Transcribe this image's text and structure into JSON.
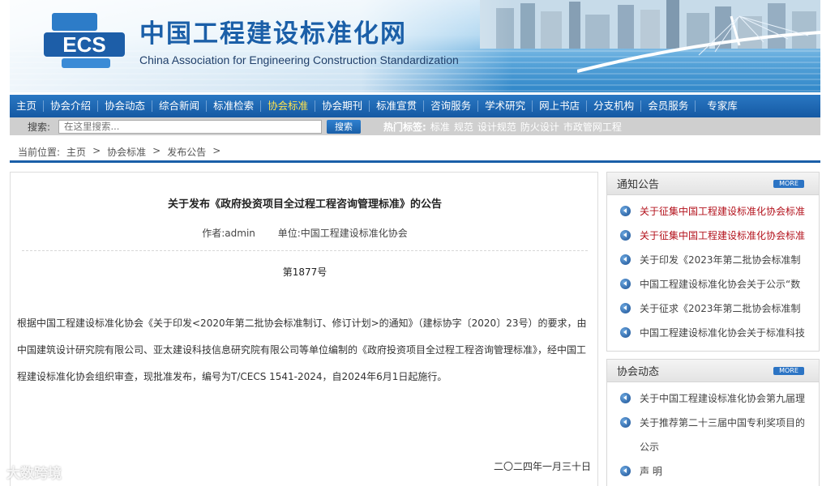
{
  "header": {
    "title": "中国工程建设标准化网",
    "subtitle": "China Association for Engineering Construction Standardization",
    "logo_text": "ECS"
  },
  "nav": {
    "items": [
      "主页",
      "协会介绍",
      "协会动态",
      "综合新闻",
      "标准检索",
      "协会标准",
      "协会期刊",
      "标准宣贯",
      "咨询服务",
      "学术研究",
      "网上书店",
      "分支机构",
      "会员服务",
      "专家库"
    ],
    "active": "协会标准"
  },
  "search": {
    "label": "搜索:",
    "placeholder": "在这里搜索...",
    "button": "搜索",
    "hot_label": "热门标签:",
    "hot_tags": [
      "标准",
      "规范",
      "设计规范",
      "防火设计",
      "市政管网工程"
    ]
  },
  "breadcrumb": {
    "prefix": "当前位置:",
    "items": [
      "主页",
      "协会标准",
      "发布公告"
    ],
    "sep": ">"
  },
  "article": {
    "title": "关于发布《政府投资项目全过程工程咨询管理标准》的公告",
    "author": "作者:admin",
    "unit": "单位:中国工程建设标准化协会",
    "number": "第1877号",
    "body": "根据中国工程建设标准化协会《关于印发<2020年第二批协会标准制订、修订计划>的通知》（建标协字〔2020〕23号）的要求，由中国建筑设计研究院有限公司、亚太建设科技信息研究院有限公司等单位编制的《政府投资项目全过程工程咨询管理标准》，经中国工程建设标准化协会组织审查，现批准发布，编号为T/CECS 1541-2024，自2024年6月1日起施行。",
    "date": "二〇二四年一月三十日"
  },
  "sidebar": {
    "more_label": "MORE",
    "notices": {
      "title": "通知公告",
      "items": [
        {
          "text": "关于征集中国工程建设标准化协会标准",
          "highlight": true
        },
        {
          "text": "关于征集中国工程建设标准化协会标准",
          "highlight": true
        },
        {
          "text": "关于印发《2023年第二批协会标准制",
          "highlight": false
        },
        {
          "text": "中国工程建设标准化协会关于公示“数",
          "highlight": false
        },
        {
          "text": "关于征求《2023年第二批协会标准制",
          "highlight": false
        },
        {
          "text": "中国工程建设标准化协会关于标准科技",
          "highlight": false
        }
      ]
    },
    "news": {
      "title": "协会动态",
      "items": [
        {
          "text": "关于中国工程建设标准化协会第九届理"
        },
        {
          "text": "关于推荐第二十三届中国专利奖项目的"
        },
        {
          "text": "公示"
        },
        {
          "text": "声 明"
        }
      ]
    }
  },
  "watermark": "大数跨境",
  "colors": {
    "nav_bg": "#1a5fa8",
    "active_nav": "#ffe34d",
    "highlight_link": "#b3121c"
  }
}
